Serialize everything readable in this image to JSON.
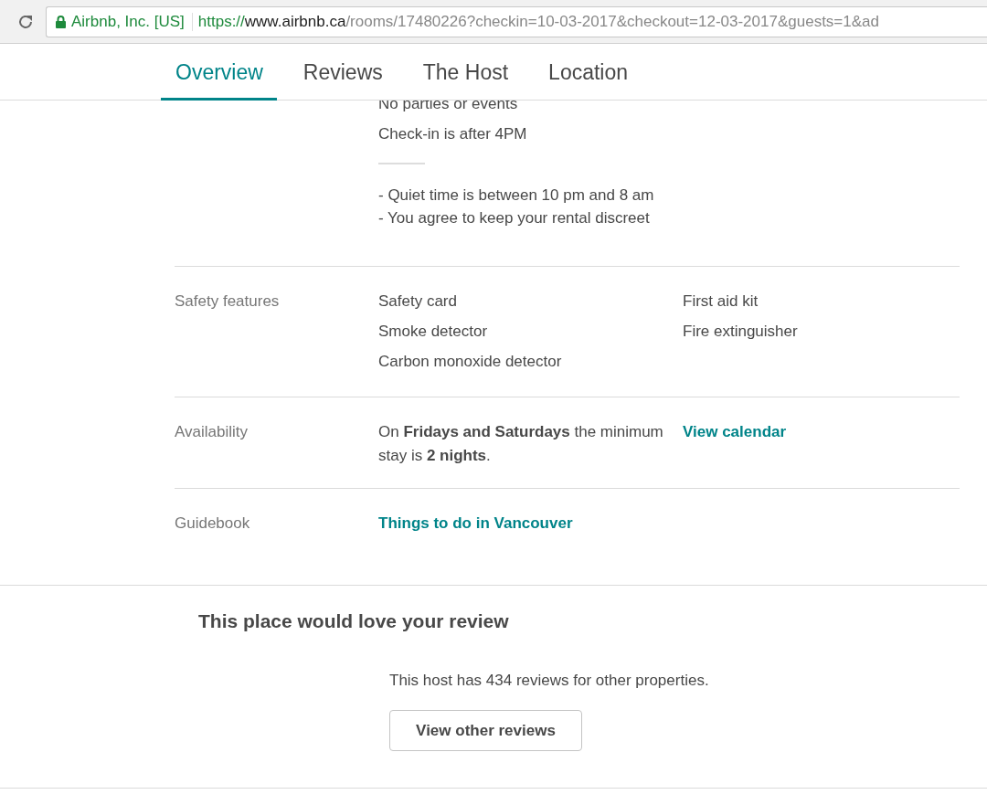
{
  "address_bar": {
    "site_identity": "Airbnb, Inc. [US]",
    "scheme": "https://",
    "host": "www.airbnb.ca",
    "path": "/rooms/17480226?checkin=10-03-2017&checkout=12-03-2017&guests=1&ad"
  },
  "tabs": [
    {
      "label": "Overview",
      "selected": true
    },
    {
      "label": "Reviews",
      "selected": false
    },
    {
      "label": "The Host",
      "selected": false
    },
    {
      "label": "Location",
      "selected": false
    }
  ],
  "house_rules": {
    "rules": [
      "No parties or events",
      "Check-in is after 4PM"
    ],
    "additional_rules": [
      "- Quiet time is between 10 pm and 8 am",
      "- You agree to keep your rental discreet"
    ]
  },
  "details": [
    {
      "label": "Safety features",
      "kind": "list",
      "column_1": [
        "Safety card",
        "Smoke detector",
        "Carbon monoxide detector"
      ],
      "column_2": [
        "First aid kit",
        "Fire extinguisher"
      ]
    },
    {
      "label": "Availability",
      "kind": "text",
      "text": "On **Fridays and Saturdays** the minimum stay is **2 nights**.",
      "link": "View calendar"
    },
    {
      "label": "Guidebook",
      "kind": "link",
      "link": "Things to do in Vancouver"
    }
  ],
  "review_prompt": {
    "title": "This place would love your review",
    "text": "This host has 434 reviews for other properties.",
    "button": "View other reviews"
  }
}
